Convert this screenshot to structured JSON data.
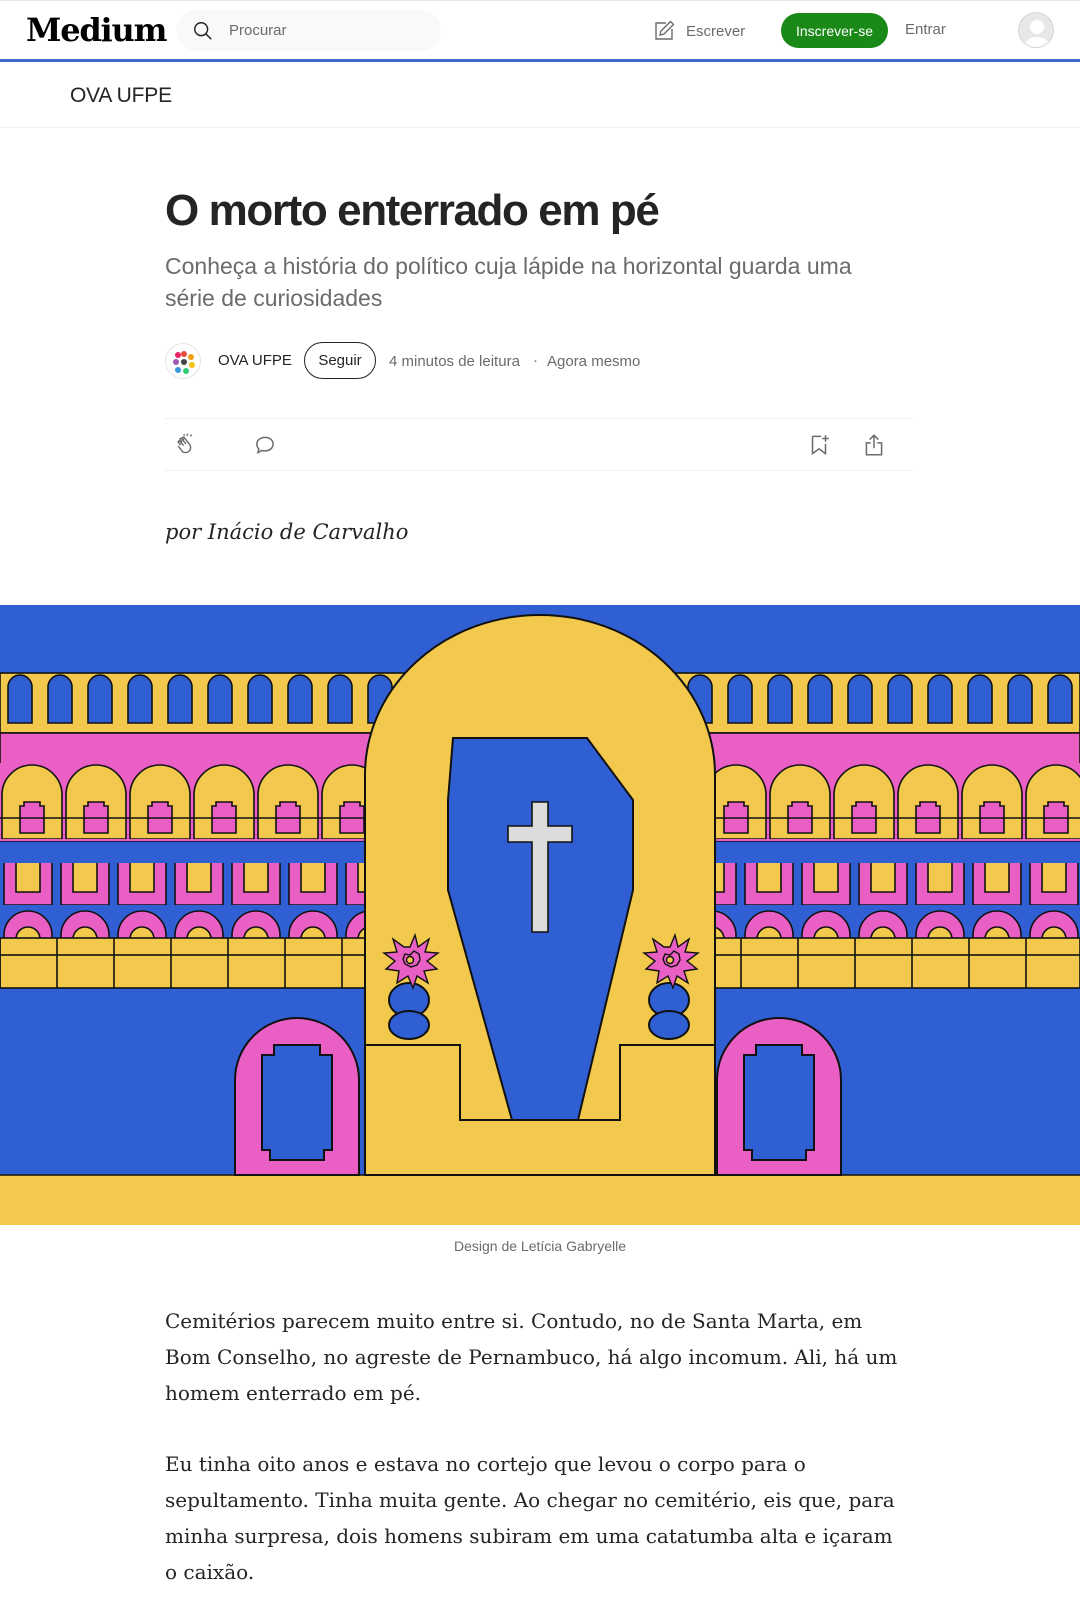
{
  "header": {
    "logo": "Medium",
    "search_placeholder": "Procurar",
    "write_label": "Escrever",
    "signup_label": "Inscrever-se",
    "signin_label": "Entrar"
  },
  "publication": {
    "name": "OVA UFPE"
  },
  "article": {
    "title": "O morto enterrado em pé",
    "subtitle": "Conheça a história do político cuja lápide na horizontal guarda uma série de curiosidades",
    "author": "OVA UFPE",
    "follow_label": "Seguir",
    "read_time": "4 minutos de leitura",
    "separator": "·",
    "published": "Agora mesmo",
    "byline": "por Inácio de Carvalho",
    "image_caption": "Design de Letícia Gabryelle",
    "paragraphs": [
      "Cemitérios parecem muito entre si. Contudo, no de Santa Marta, em Bom Conselho, no agreste de Pernambuco, há algo incomum. Ali, há um homem enterrado em pé.",
      "Eu tinha oito anos e estava no cortejo que levou o corpo para o sepultamento. Tinha muita gente. Ao chegar no cemitério, eis que, para minha surpresa, dois homens subiram em uma catatumba alta e içaram o caixão."
    ]
  },
  "icons": [
    "search-icon",
    "write-icon",
    "clap-icon",
    "comment-icon",
    "bookmark-icon",
    "share-icon"
  ],
  "colors": {
    "accent_green": "#1a8917",
    "illus_blue": "#2f5fd3",
    "illus_yellow": "#f2c94c",
    "illus_pink": "#e95fc3"
  }
}
